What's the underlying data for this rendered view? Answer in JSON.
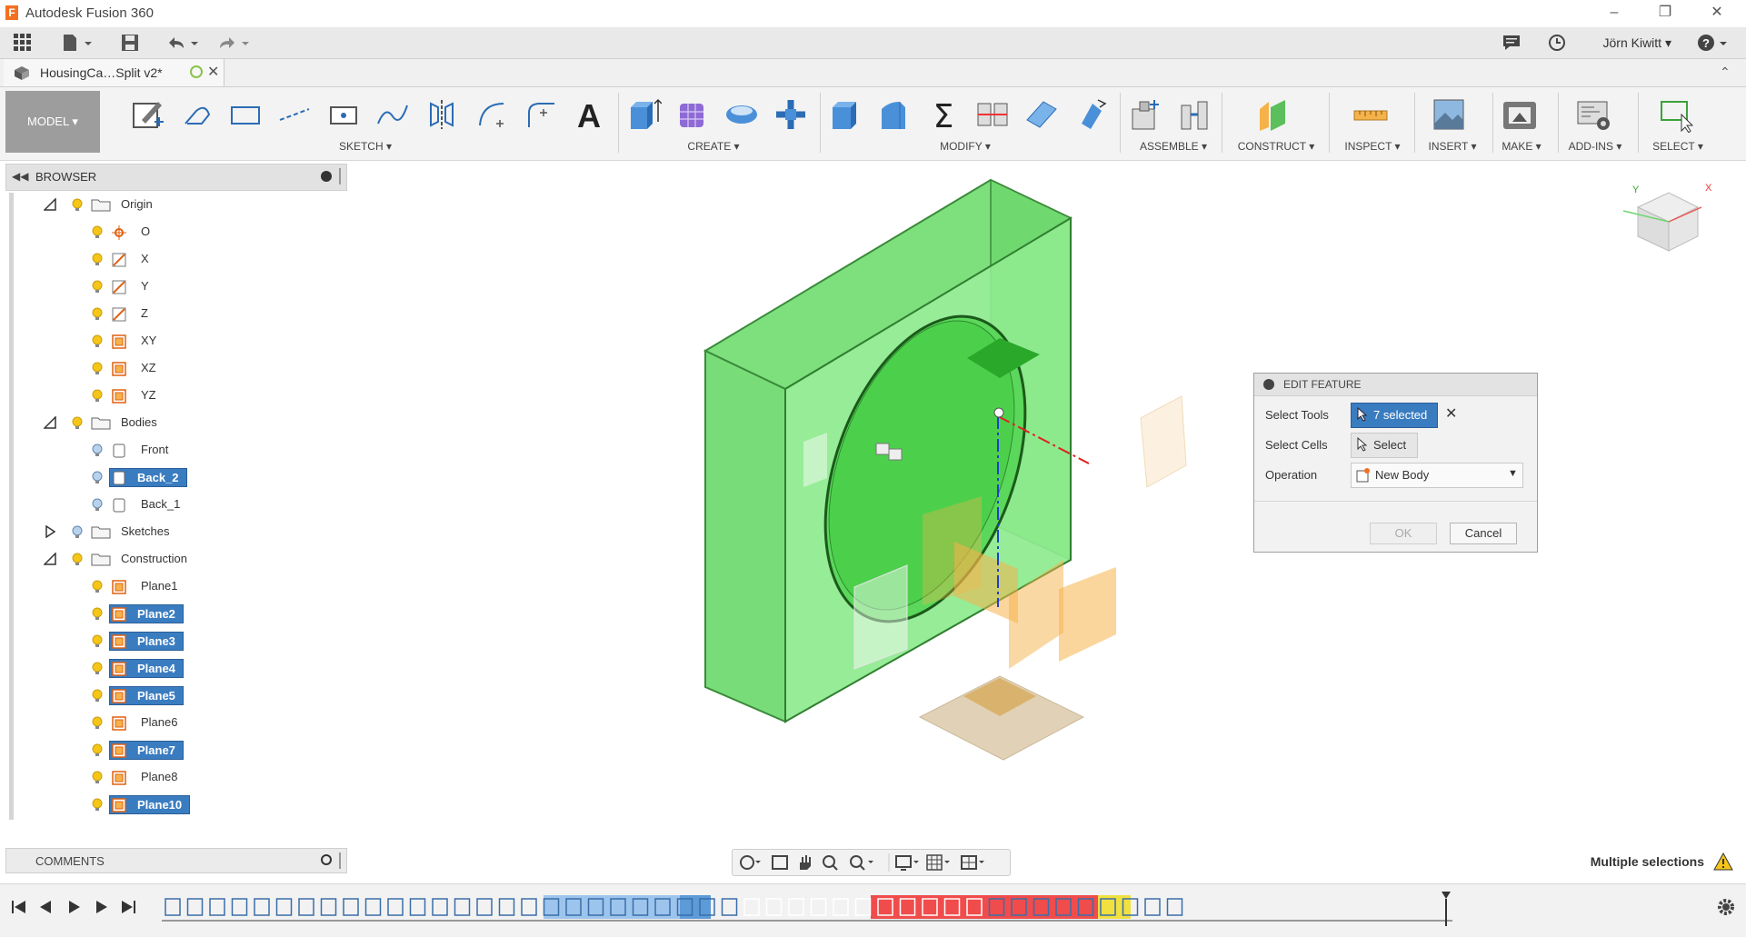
{
  "window": {
    "title": "Autodesk Fusion 360",
    "app_icon_letter": "F"
  },
  "quick_access": {
    "user": "Jörn Kiwitt"
  },
  "document_tab": {
    "label": "HousingCa…Split v2*"
  },
  "ribbon": {
    "mode": "MODEL",
    "groups": [
      {
        "label": "SKETCH"
      },
      {
        "label": "CREATE"
      },
      {
        "label": "MODIFY"
      },
      {
        "label": "ASSEMBLE"
      },
      {
        "label": "CONSTRUCT"
      },
      {
        "label": "INSPECT"
      },
      {
        "label": "INSERT"
      },
      {
        "label": "MAKE"
      },
      {
        "label": "ADD-INS"
      },
      {
        "label": "SELECT"
      }
    ]
  },
  "browser": {
    "title": "BROWSER",
    "items": [
      {
        "label": "Origin",
        "kind": "folder",
        "selected": false
      },
      {
        "label": "O",
        "kind": "origin-point",
        "selected": false
      },
      {
        "label": "X",
        "kind": "axis",
        "selected": false
      },
      {
        "label": "Y",
        "kind": "axis",
        "selected": false
      },
      {
        "label": "Z",
        "kind": "axis",
        "selected": false
      },
      {
        "label": "XY",
        "kind": "plane",
        "selected": false
      },
      {
        "label": "XZ",
        "kind": "plane",
        "selected": false
      },
      {
        "label": "YZ",
        "kind": "plane",
        "selected": false
      },
      {
        "label": "Bodies",
        "kind": "folder",
        "selected": false
      },
      {
        "label": "Front",
        "kind": "body",
        "selected": false
      },
      {
        "label": "Back_2",
        "kind": "body",
        "selected": true
      },
      {
        "label": "Back_1",
        "kind": "body",
        "selected": false
      },
      {
        "label": "Sketches",
        "kind": "folder",
        "selected": false
      },
      {
        "label": "Construction",
        "kind": "folder",
        "selected": false
      },
      {
        "label": "Plane1",
        "kind": "plane",
        "selected": false
      },
      {
        "label": "Plane2",
        "kind": "plane",
        "selected": true
      },
      {
        "label": "Plane3",
        "kind": "plane",
        "selected": true
      },
      {
        "label": "Plane4",
        "kind": "plane",
        "selected": true
      },
      {
        "label": "Plane5",
        "kind": "plane",
        "selected": true
      },
      {
        "label": "Plane6",
        "kind": "plane",
        "selected": false
      },
      {
        "label": "Plane7",
        "kind": "plane",
        "selected": true
      },
      {
        "label": "Plane8",
        "kind": "plane",
        "selected": false
      },
      {
        "label": "Plane10",
        "kind": "plane",
        "selected": true
      }
    ]
  },
  "comments": {
    "title": "COMMENTS"
  },
  "edit_feature": {
    "title": "EDIT FEATURE",
    "select_tools_label": "Select Tools",
    "select_tools_value": "7 selected",
    "select_cells_label": "Select Cells",
    "select_cells_value": "Select",
    "operation_label": "Operation",
    "operation_value": "New Body",
    "ok_label": "OK",
    "cancel_label": "Cancel"
  },
  "status": {
    "message": "Multiple selections"
  },
  "viewcube": {
    "axis_x": "X",
    "axis_y": "Y"
  },
  "colors": {
    "selection_blue": "#3a7cc0",
    "body_green": "#5be05b",
    "plane_orange": "#f5b24a",
    "timeline_red": "#f03a3a",
    "timeline_yellow": "#f0e040"
  }
}
